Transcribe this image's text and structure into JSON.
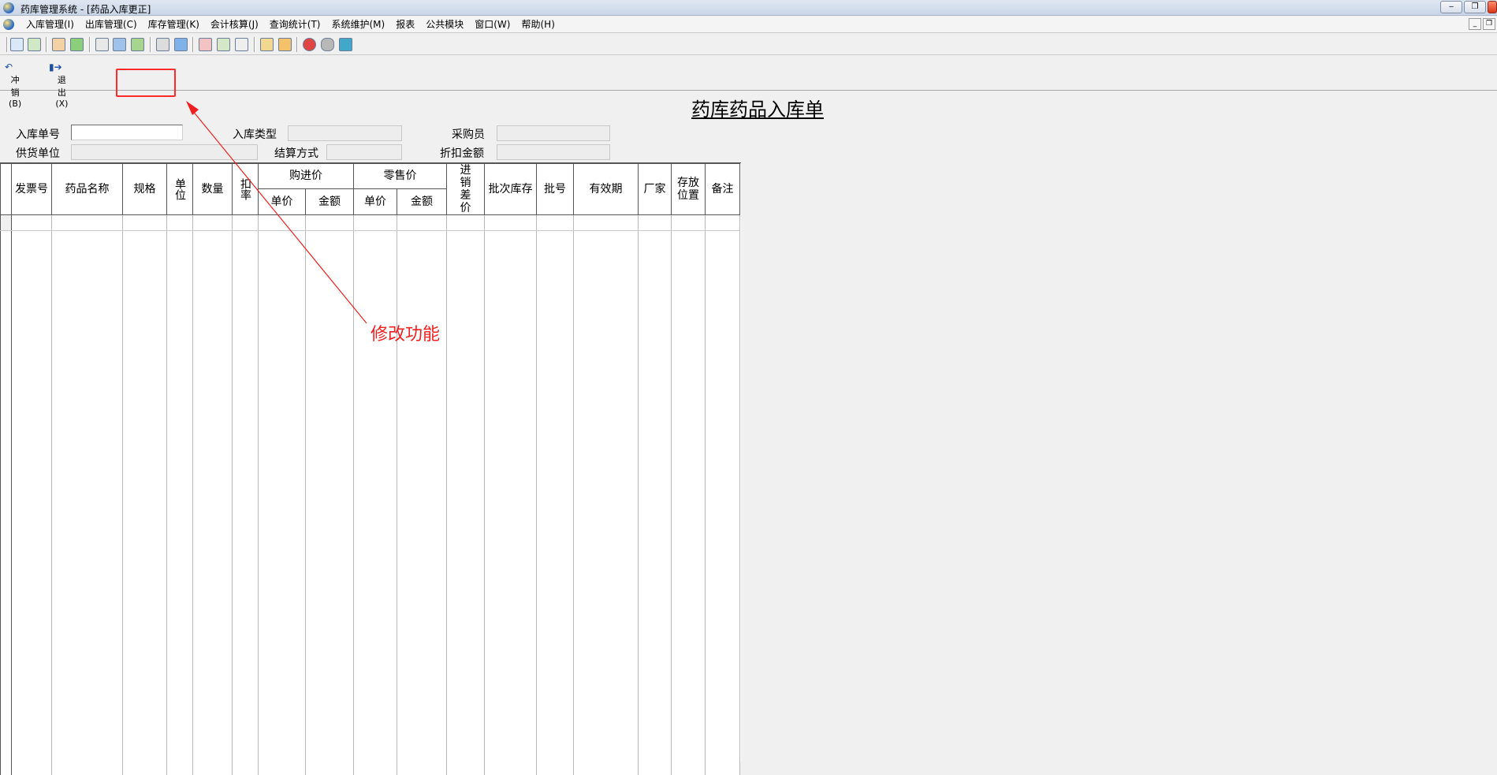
{
  "window": {
    "title": "药库管理系统 - [药品入库更正]",
    "icon": "app-globe-icon",
    "buttons": [
      "minimize",
      "restore",
      "close"
    ]
  },
  "menubar": {
    "items": [
      "入库管理(I)",
      "出库管理(C)",
      "库存管理(K)",
      "会计核算(J)",
      "查询统计(T)",
      "系统维护(M)",
      "报表",
      "公共模块",
      "窗口(W)",
      "帮助(H)"
    ]
  },
  "toolbar": {
    "icons": [
      "open-icon",
      "check-icon",
      "export-icon",
      "approve-icon",
      "clipboard-icon",
      "card-icon",
      "battery-icon",
      "print-preview-icon",
      "book-icon",
      "report-icon",
      "chart-icon",
      "search-icon",
      "folder-icon",
      "thermometer-icon",
      "stop-icon",
      "cloud-icon",
      "close-window-icon"
    ]
  },
  "actions": {
    "reverse_label": "冲销(B)",
    "exit_label": "退出(X)"
  },
  "form": {
    "title": "药库药品入库单",
    "labels": {
      "order_no": "入库单号",
      "type": "入库类型",
      "buyer": "采购员",
      "supplier": "供货单位",
      "settlement": "结算方式",
      "discount": "折扣金额"
    },
    "values": {
      "order_no": "",
      "type": "",
      "buyer": "",
      "supplier": "",
      "settlement": "",
      "discount": ""
    }
  },
  "grid": {
    "headers": {
      "invoice": "发票号",
      "drug_name": "药品名称",
      "spec": "规格",
      "unit": "单位",
      "quantity": "数量",
      "markup": "扣率",
      "purchase_group": "购进价",
      "retail_group": "零售价",
      "unit_price": "单价",
      "amount": "金额",
      "diff": "进销差价",
      "batch_stock": "批次库存",
      "batch_no": "批号",
      "expiry": "有效期",
      "maker": "厂家",
      "location": "存放位置",
      "remark": "备注"
    },
    "rows": []
  },
  "annotation": {
    "text": "修改功能",
    "color": "#f02020"
  }
}
